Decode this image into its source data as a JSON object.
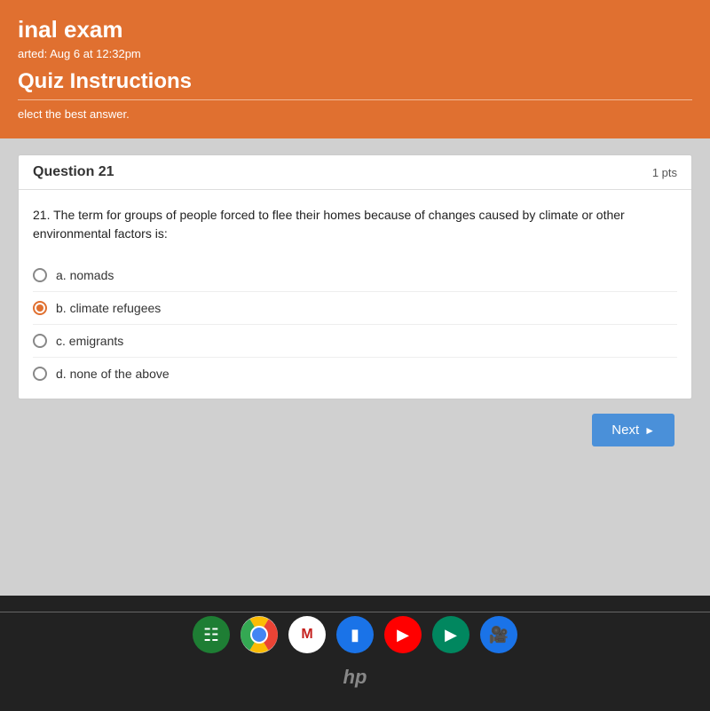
{
  "header": {
    "exam_title": "inal exam",
    "started_text": "arted: Aug 6 at 12:32pm",
    "instructions_title": "Quiz Instructions",
    "select_text": "elect the best answer."
  },
  "question": {
    "label": "Question 21",
    "points": "1 pts",
    "number": "21.",
    "text": "The term for groups of people forced to flee their homes because of changes caused by climate or other environmental factors is:",
    "options": [
      {
        "id": "a",
        "label": "a. nomads",
        "selected": false
      },
      {
        "id": "b",
        "label": "b. climate refugees",
        "selected": true
      },
      {
        "id": "c",
        "label": "c. emigrants",
        "selected": false
      },
      {
        "id": "d",
        "label": "d. none of the above",
        "selected": false
      }
    ]
  },
  "buttons": {
    "next_label": "Next"
  },
  "taskbar": {
    "hp_logo": "hp"
  }
}
